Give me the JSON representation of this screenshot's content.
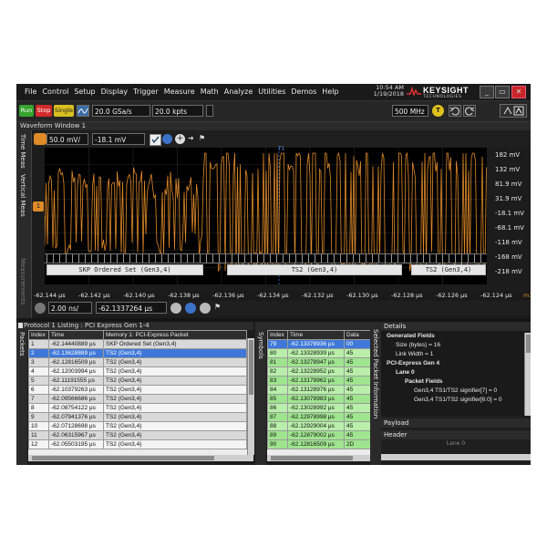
{
  "menu": [
    "File",
    "Control",
    "Setup",
    "Display",
    "Trigger",
    "Measure",
    "Math",
    "Analyze",
    "Utilities",
    "Demos",
    "Help"
  ],
  "status": {
    "time": "10:54 AM",
    "date": "1/19/2018"
  },
  "brand": {
    "name": "KEYSIGHT",
    "sub": "TECHNOLOGIES"
  },
  "toolbar": {
    "run_label": "Run",
    "stop_label": "Stop",
    "single_label": "Single",
    "sample_rate": "20.0 GSa/s",
    "memory_depth": "20.0 kpts",
    "bandwidth": "500 MHz",
    "trigger_mode": "T"
  },
  "waveform_window": {
    "title": "Waveform Window 1",
    "side_tabs": [
      "Time Meas",
      "Vertical Meas",
      "Measurements"
    ],
    "channel_scale": "50.0 mV/",
    "channel_offset": "-18.1 mV",
    "trigger_marker": "T1",
    "y_axis_labels": [
      "182 mV",
      "132 mV",
      "81.9 mV",
      "31.9 mV",
      "-18.1 mV",
      "-68.1 mV",
      "-118 mV",
      "-168 mV",
      "-218 mV"
    ],
    "x_axis_labels": [
      "-62.144 µs",
      "-62.142 µs",
      "-62.140 µs",
      "-62.138 µs",
      "-62.136 µs",
      "-62.134 µs",
      "-62.132 µs",
      "-62.130 µs",
      "-62.128 µs",
      "-62.126 µs",
      "-62.124 µs"
    ],
    "x_axis_suffix": "m1",
    "bus_segments": [
      {
        "label": "SKP Ordered Set (Gen3,4)"
      },
      {
        "label": "TS2 (Gen3,4)"
      },
      {
        "label": "TS2 (Gen3,4)"
      }
    ],
    "horizontal_scale": "2.00 ns/",
    "horizontal_position": "-62.1337264 µs",
    "trace_color": "#e08a28"
  },
  "protocol_listing": {
    "title": "Protocol 1 Listing : PCI Express Gen 1-4",
    "side_tab": "Packets",
    "columns": [
      "Index",
      "Time",
      "Memory 1: PCI-Express Packet"
    ],
    "rows": [
      [
        "1",
        "-62.14440889 µs",
        "SKP Ordered Set (Gen3,4)"
      ],
      [
        "2",
        "-62.13628889 µs",
        "TS2 (Gen3,4)"
      ],
      [
        "3",
        "-62.12816509 µs",
        "TS2 (Gen3,4)"
      ],
      [
        "4",
        "-62.12003994 µs",
        "TS2 (Gen3,4)"
      ],
      [
        "5",
        "-62.11191555 µs",
        "TS2 (Gen3,4)"
      ],
      [
        "6",
        "-62.10379263 µs",
        "TS2 (Gen3,4)"
      ],
      [
        "7",
        "-62.09566686 µs",
        "TS2 (Gen3,4)"
      ],
      [
        "8",
        "-62.08754122 µs",
        "TS2 (Gen3,4)"
      ],
      [
        "9",
        "-62.07941376 µs",
        "TS2 (Gen3,4)"
      ],
      [
        "10",
        "-62.07128698 µs",
        "TS2 (Gen3,4)"
      ],
      [
        "11",
        "-62.06315967 µs",
        "TS2 (Gen3,4)"
      ],
      [
        "12",
        "-62.05503195 µs",
        "TS2 (Gen3,4)"
      ]
    ]
  },
  "symbols": {
    "side_tab": "Symbols",
    "columns": [
      "Index",
      "Time",
      "Data"
    ],
    "rows": [
      [
        "79",
        "-62.13378936 µs",
        "00"
      ],
      [
        "80",
        "-62.13328939 µs",
        "45"
      ],
      [
        "81",
        "-62.13278947 µs",
        "45"
      ],
      [
        "82",
        "-62.13228952 µs",
        "45"
      ],
      [
        "83",
        "-62.13178962 µs",
        "45"
      ],
      [
        "84",
        "-62.13128976 µs",
        "45"
      ],
      [
        "85",
        "-62.13078983 µs",
        "45"
      ],
      [
        "86",
        "-62.13028992 µs",
        "45"
      ],
      [
        "87",
        "-62.12978998 µs",
        "45"
      ],
      [
        "88",
        "-62.12929004 µs",
        "45"
      ],
      [
        "89",
        "-62.12879002 µs",
        "45"
      ],
      [
        "90",
        "-62.12816509 µs",
        "2D"
      ]
    ]
  },
  "details": {
    "title": "Details",
    "side_tab": "Selected Packet Information",
    "tree": [
      {
        "text": "Generated Fields",
        "level": 0,
        "bold": true
      },
      {
        "text": "Size (bytes) = 16",
        "level": 1
      },
      {
        "text": "Link Width = 1",
        "level": 1
      },
      {
        "text": "PCI-Express Gen 4",
        "level": 0,
        "bold": true
      },
      {
        "text": "Lane 0",
        "level": 1,
        "bold": true
      },
      {
        "text": "Packet Fields",
        "level": 2,
        "bold": true
      },
      {
        "text": "Gen3,4 TS1/TS2 signifier[7] = 0",
        "level": 3
      },
      {
        "text": "Gen3,4 TS1/TS2 signifier[6:0] = 0",
        "level": 3
      }
    ],
    "payload_label": "Payload",
    "header_label": "Header",
    "header_lane": "Lane 0"
  }
}
